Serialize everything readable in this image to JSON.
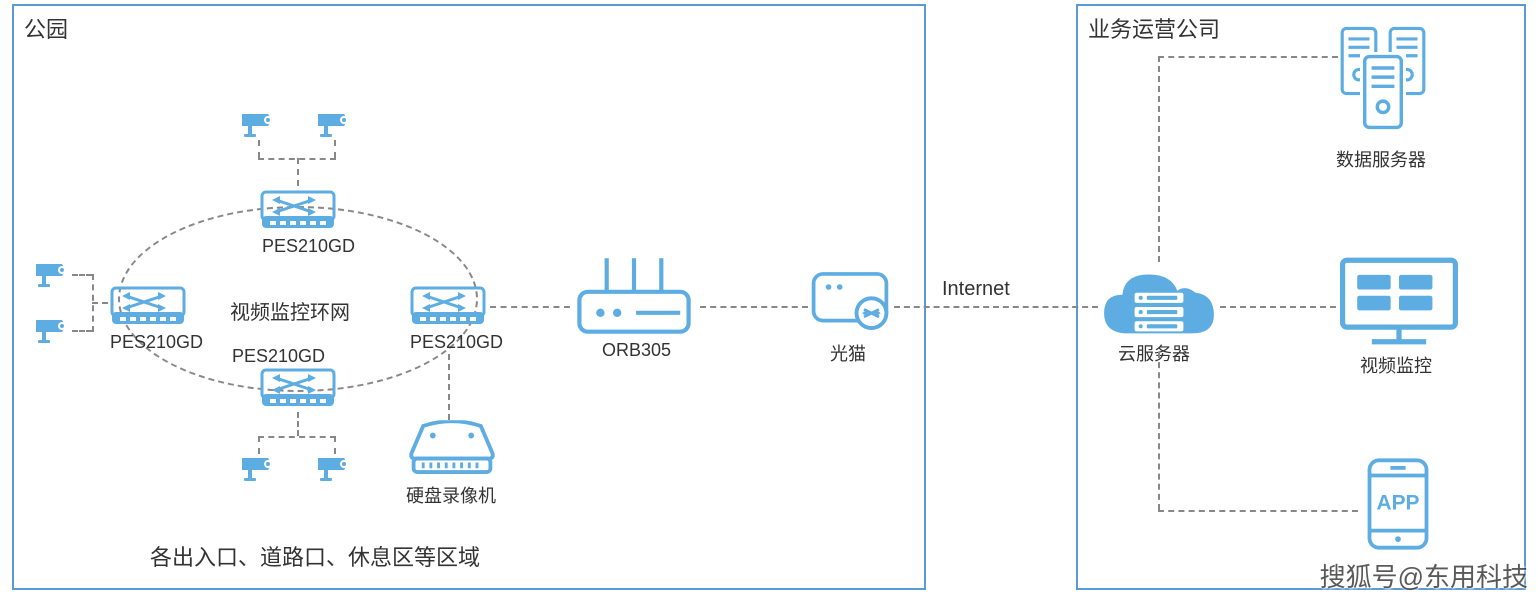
{
  "colors": {
    "accent": "#5DADE2",
    "border": "#5B9BD5",
    "dash": "#888888"
  },
  "boxes": {
    "left": {
      "title": "公园"
    },
    "right": {
      "title": "业务运营公司"
    }
  },
  "ring": {
    "center_label": "视频监控环网",
    "switches": {
      "top": "PES210GD",
      "left": "PES210GD",
      "right": "PES210GD",
      "bottom": "PES210GD"
    }
  },
  "devices": {
    "nvr": "硬盘录像机",
    "router": "ORB305",
    "modem": "光猫",
    "internet": "Internet",
    "cloud": "云服务器",
    "data_server": "数据服务器",
    "video_monitor": "视频监控",
    "app": "APP"
  },
  "footer": "各出入口、道路口、休息区等区域",
  "watermark": "搜狐号@东用科技",
  "icons": {
    "camera": "camera-icon",
    "switch": "switch-icon",
    "router": "router-icon",
    "modem": "modem-icon",
    "nvr": "nvr-icon",
    "cloud": "cloud-server-icon",
    "server": "server-icon",
    "monitor": "monitor-icon",
    "app": "app-icon"
  }
}
